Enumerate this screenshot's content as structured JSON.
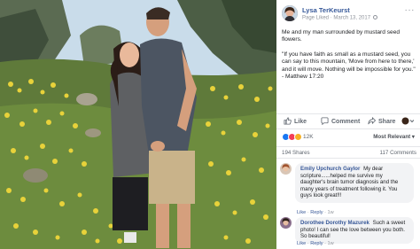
{
  "post": {
    "author": "Lysa TerKeurst",
    "visibility": "Page Liked",
    "date": "March 13, 2017",
    "more_menu": "···",
    "caption_lines": [
      "Me and my man surrounded by mustard seed flowers.",
      "\"If you have faith as small as a mustard seed, you can say to this mountain, 'Move from here to there,' and it will move. Nothing will be impossible for you.\" - Matthew 17:20"
    ]
  },
  "actions": {
    "like": "Like",
    "comment": "Comment",
    "share": "Share"
  },
  "reactions": {
    "count": "12K",
    "sort": "Most Relevant ▾"
  },
  "counts": {
    "shares": "194 Shares",
    "comments": "117 Comments"
  },
  "comments": [
    {
      "name": "Emily Upchurch Gaylor",
      "text": "My dear scripture......helped me survive my daughter's brain tumor diagnosis and the many years of treatment following it. You guys look great!!!",
      "like": "Like",
      "reply": "Reply",
      "time": "1w"
    },
    {
      "name": "Dorothee Dorothy Mazurek",
      "text": "Such a sweet photo! I can see the love between you both. So beautiful!",
      "like": "Like",
      "reply": "Reply",
      "time": "1w"
    }
  ],
  "colors": {
    "link_blue": "#365899",
    "like_blue": "#1877f2",
    "love_red": "#f33e58",
    "flower_yellow": "#e8d23a",
    "bubble_gray": "#f2f3f5"
  },
  "icons": [
    "more-icon",
    "globe-icon",
    "like-icon",
    "comment-icon",
    "share-icon",
    "like-reaction-icon",
    "love-reaction-icon",
    "wow-reaction-icon"
  ]
}
